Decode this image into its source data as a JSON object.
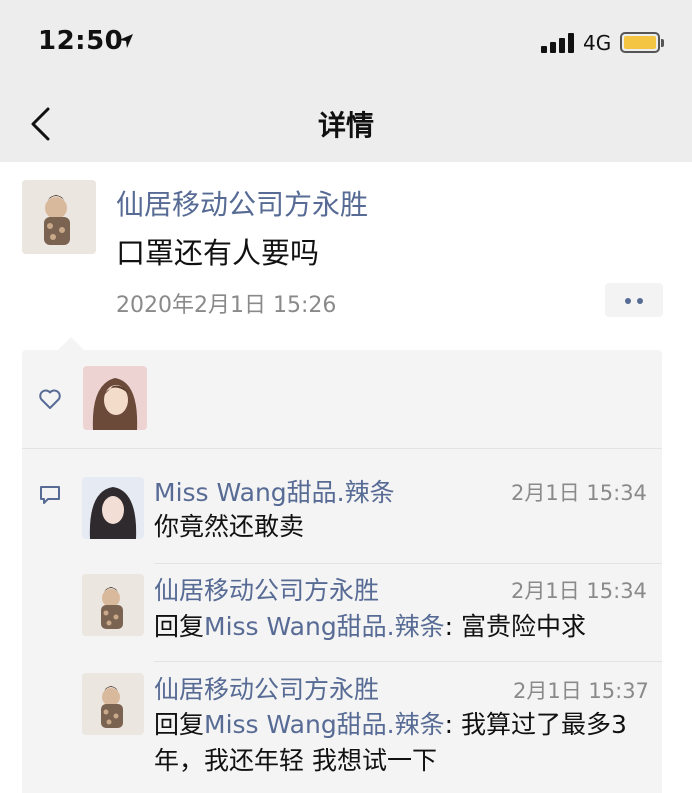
{
  "status_bar": {
    "time": "12:50",
    "network": "4G"
  },
  "nav": {
    "title": "详情"
  },
  "post": {
    "author": "仙居移动公司方永胜",
    "content": "口罩还有人要吗",
    "timestamp": "2020年2月1日 15:26"
  },
  "comments": [
    {
      "name": "Miss Wang甜品.辣条",
      "time": "2月1日 15:34",
      "text": "你竟然还敢卖"
    },
    {
      "name": "仙居移动公司方永胜",
      "time": "2月1日 15:34",
      "reply_prefix": "回复",
      "reply_to": "Miss Wang甜品.辣条",
      "text": ": 富贵险中求"
    },
    {
      "name": "仙居移动公司方永胜",
      "time": "2月1日 15:37",
      "reply_prefix": "回复",
      "reply_to": "Miss Wang甜品.辣条",
      "text": ": 我算过了最多3年，我还年轻  我想试一下"
    }
  ],
  "colors": {
    "link": "#576b95",
    "battery": "#f4c542",
    "bar_bg": "#ededed",
    "panel_bg": "#f4f4f4"
  }
}
